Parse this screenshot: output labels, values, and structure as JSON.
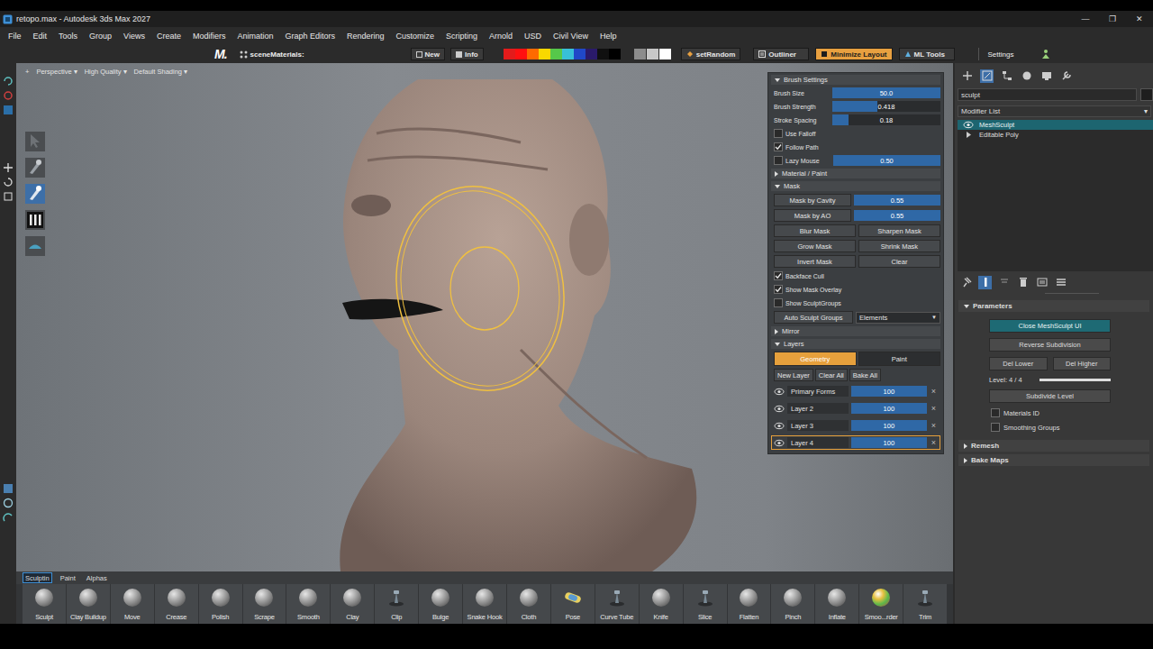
{
  "window": {
    "title": "retopo.max - Autodesk 3ds Max 2027",
    "controls": [
      "—",
      "❐",
      "✕"
    ]
  },
  "menu": [
    "File",
    "Edit",
    "Tools",
    "Group",
    "Views",
    "Create",
    "Modifiers",
    "Animation",
    "Graph Editors",
    "Rendering",
    "Customize",
    "Scripting",
    "Arnold",
    "USD",
    "Civil View",
    "Help"
  ],
  "toolbar": {
    "logo": "M.",
    "scene_label": "sceneMaterials:",
    "buttons": [
      {
        "label": "New"
      },
      {
        "label": "Info"
      }
    ],
    "swatches": [
      {
        "color": "#e31b1b"
      },
      {
        "color": "#ff1010"
      },
      {
        "color": "#ff6a00"
      },
      {
        "color": "#f8d800"
      },
      {
        "color": "#56c84a"
      },
      {
        "color": "#38c0d8"
      },
      {
        "color": "#2048c8"
      },
      {
        "color": "#2a1a6a"
      },
      {
        "color": "#101010"
      },
      {
        "color": "#000000"
      }
    ],
    "greys": [
      {
        "color": "#8c8c8c"
      },
      {
        "color": "#c8c8c8"
      },
      {
        "color": "#ffffff"
      }
    ],
    "tools": [
      {
        "label": "setRandom",
        "selected": false
      },
      {
        "label": "Outliner",
        "selected": false
      },
      {
        "label": "Minimize Layout",
        "selected": true
      },
      {
        "label": "ML Tools",
        "selected": false
      }
    ],
    "settings": "Settings"
  },
  "viewport": {
    "labels": [
      "+",
      "Perspective ▾",
      "High Quality ▾",
      "Default Shading ▾"
    ],
    "tools": [
      {
        "selected": false
      },
      {
        "selected": false
      },
      {
        "selected": true
      },
      {
        "selected": false
      },
      {
        "selected": false
      }
    ]
  },
  "brush_panel": {
    "sections": [
      {
        "title": "Brush Settings",
        "expanded": true,
        "rows": [
          {
            "kind": "slider",
            "label": "Brush Size",
            "value": "50.0",
            "level": 1
          },
          {
            "kind": "slider",
            "label": "Brush Strength",
            "value": "0.418",
            "level": 0.418
          },
          {
            "kind": "slider",
            "label": "Stroke Spacing",
            "value": "0.18",
            "level": 0.15
          },
          {
            "kind": "checkbox",
            "label": "Use Falloff",
            "checked": false
          },
          {
            "kind": "checkbox",
            "label": "Follow Path",
            "checked": true
          },
          {
            "kind": "checkslider",
            "label": "Lazy Mouse",
            "checked": false,
            "value": "0.50",
            "level": 1
          }
        ]
      },
      {
        "title": "Material / Paint",
        "expanded": false,
        "rows": []
      },
      {
        "title": "Mask",
        "expanded": true,
        "rows": [
          {
            "kind": "buttonslider",
            "label": "Mask by Cavity",
            "value": "0.55",
            "level": 1
          },
          {
            "kind": "buttonslider",
            "label": "Mask by AO",
            "value": "0.55",
            "level": 1
          },
          {
            "kind": "buttons",
            "buttons": [
              "Blur Mask",
              "Sharpen Mask"
            ]
          },
          {
            "kind": "buttons",
            "buttons": [
              "Grow Mask",
              "Shrink Mask"
            ]
          },
          {
            "kind": "buttons",
            "buttons": [
              "Invert Mask",
              "Clear"
            ]
          },
          {
            "kind": "checkbox",
            "label": "Backface Cull",
            "checked": true
          },
          {
            "kind": "checkbox",
            "label": "Show Mask Overlay",
            "checked": true
          },
          {
            "kind": "checkbox",
            "label": "Show SculptGroups",
            "checked": false
          },
          {
            "kind": "dropdown",
            "label": "Auto Sculpt Groups",
            "value": "Elements",
            "arrow": "▼"
          }
        ]
      },
      {
        "title": "Mirror",
        "expanded": false,
        "rows": []
      },
      {
        "title": "Layers",
        "expanded": true,
        "rows": [
          {
            "kind": "tabs",
            "tabs": [
              {
                "label": "Geometry",
                "selected": true
              },
              {
                "label": "Paint",
                "selected": false
              }
            ]
          },
          {
            "kind": "smallbuttons",
            "buttons": [
              "New Layer",
              "Clear All",
              "Bake All"
            ]
          },
          {
            "kind": "layer",
            "label": "Primary Forms",
            "value": "100",
            "level": 1,
            "visible": true,
            "selected": false,
            "remove": "×"
          },
          {
            "kind": "layer",
            "label": "Layer 2",
            "value": "100",
            "level": 1,
            "visible": true,
            "selected": false,
            "remove": "×"
          },
          {
            "kind": "layer",
            "label": "Layer 3",
            "value": "100",
            "level": 1,
            "visible": true,
            "selected": false,
            "remove": "×"
          },
          {
            "kind": "layer",
            "label": "Layer 4",
            "value": "100",
            "level": 1,
            "visible": true,
            "selected": true,
            "remove": "×"
          }
        ]
      }
    ]
  },
  "brush_bar": {
    "tabs": [
      {
        "label": "Sculptin",
        "selected": true
      },
      {
        "label": "Paint",
        "selected": false
      },
      {
        "label": "Alphas",
        "selected": false
      }
    ],
    "brushes": [
      {
        "label": "Sculpt",
        "kind": "sphere"
      },
      {
        "label": "Clay Buildup",
        "kind": "sphere"
      },
      {
        "label": "Move",
        "kind": "sphere"
      },
      {
        "label": "Crease",
        "kind": "sphere"
      },
      {
        "label": "Polish",
        "kind": "sphere"
      },
      {
        "label": "Scrape",
        "kind": "sphere"
      },
      {
        "label": "Smooth",
        "kind": "sphere"
      },
      {
        "label": "Clay",
        "kind": "sphere"
      },
      {
        "label": "Clip",
        "kind": "tool"
      },
      {
        "label": "Bulge",
        "kind": "sphere"
      },
      {
        "label": "Snake Hook",
        "kind": "sphere"
      },
      {
        "label": "Cloth",
        "kind": "sphere"
      },
      {
        "label": "Pose",
        "kind": "pose"
      },
      {
        "label": "Curve Tube",
        "kind": "tool"
      },
      {
        "label": "Knife",
        "kind": "sphere"
      },
      {
        "label": "Slice",
        "kind": "tool"
      },
      {
        "label": "Flatten",
        "kind": "sphere"
      },
      {
        "label": "Pinch",
        "kind": "sphere"
      },
      {
        "label": "Inflate",
        "kind": "sphere"
      },
      {
        "label": "Smoo...rder",
        "kind": "color"
      },
      {
        "label": "Trim",
        "kind": "tool"
      }
    ]
  },
  "command_panel": {
    "tabs": [
      {
        "selected": false
      },
      {
        "selected": true
      },
      {
        "selected": false
      },
      {
        "selected": false
      },
      {
        "selected": false
      },
      {
        "selected": false
      }
    ],
    "search": "sculpt",
    "modifier_list": "Modifier List",
    "modifier_arrow": "▾",
    "stack": [
      {
        "label": "MeshSculpt",
        "selected": true,
        "kind": "eye"
      },
      {
        "label": "Editable Poly",
        "selected": false,
        "kind": "expand"
      }
    ],
    "stack_tools": [
      {
        "selected": false
      },
      {
        "selected": true
      },
      {
        "selected": false
      },
      {
        "selected": false
      },
      {
        "selected": false
      },
      {
        "selected": false
      }
    ],
    "rollouts": [
      {
        "title": "Parameters",
        "expanded": true,
        "rows": [
          {
            "kind": "button",
            "label": "Close MeshSculpt UI",
            "selected": true
          },
          {
            "kind": "button",
            "label": "Reverse Subdivision",
            "selected": false
          },
          {
            "kind": "pair",
            "buttons": [
              "Del Lower",
              "Del Higher"
            ]
          },
          {
            "kind": "level",
            "label": "Level: 4 / 4",
            "level": 1
          },
          {
            "kind": "button",
            "label": "Subdivide Level",
            "selected": false
          },
          {
            "kind": "checkbox",
            "label": "Materials ID",
            "checked": false
          },
          {
            "kind": "checkbox",
            "label": "Smoothing Groups",
            "checked": false
          }
        ]
      },
      {
        "title": "Remesh",
        "expanded": false,
        "rows": []
      },
      {
        "title": "Bake Maps",
        "expanded": false,
        "rows": []
      }
    ]
  }
}
